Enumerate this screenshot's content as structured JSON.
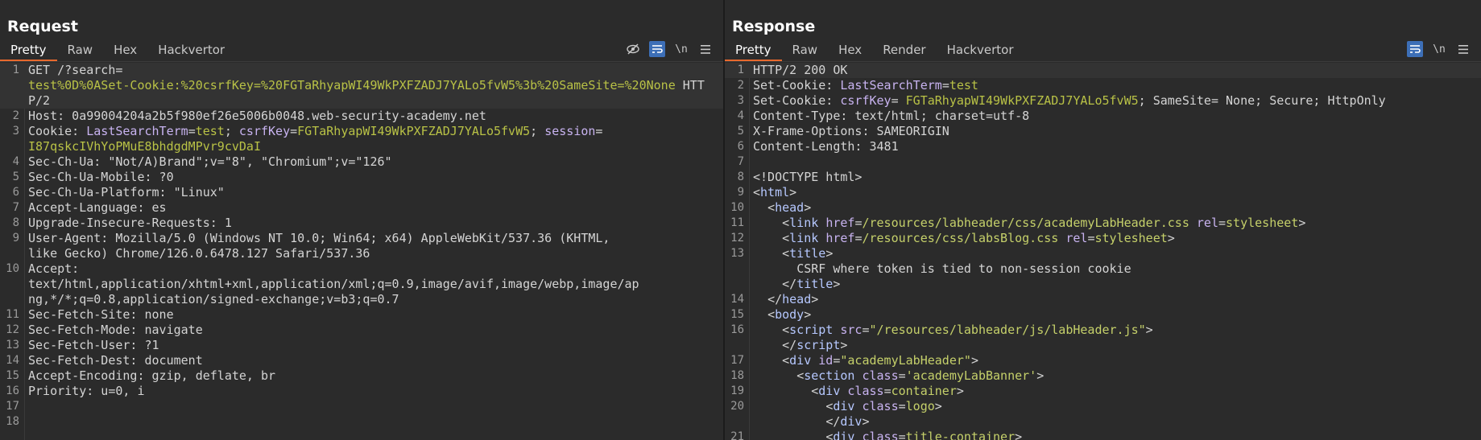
{
  "request": {
    "title": "Request",
    "tabs": [
      "Pretty",
      "Raw",
      "Hex",
      "Hackvertor"
    ],
    "active_tab": "Pretty",
    "icons": {
      "hide": "eye-slash-icon",
      "wrap": "wrap-icon",
      "newline": "\\n",
      "menu": "menu-icon"
    },
    "lines": [
      {
        "n": "1",
        "segs": [
          {
            "t": "GET /?search="
          },
          {
            "t": "\ntest%0D%0ASet-Cookie:%20csrfKey=%20FGTaRhyapWI49WkPXFZADJ7YALo5fvW5%3b%20SameSite=%20None",
            "k": "g"
          },
          {
            "t": " HTTP/2"
          }
        ],
        "hl": true
      },
      {
        "n": "2",
        "segs": [
          {
            "t": "Host: 0a99004204a2b5f980ef26e5006b0048.web-security-academy.net"
          }
        ]
      },
      {
        "n": "3",
        "segs": [
          {
            "t": "Cookie: "
          },
          {
            "t": "LastSearchTerm",
            "k": "c"
          },
          {
            "t": "="
          },
          {
            "t": "test",
            "k": "g"
          },
          {
            "t": "; "
          },
          {
            "t": "csrfKey",
            "k": "c"
          },
          {
            "t": "="
          },
          {
            "t": "FGTaRhyapWI49WkPXFZADJ7YALo5fvW5",
            "k": "g"
          },
          {
            "t": "; "
          },
          {
            "t": "session",
            "k": "c"
          },
          {
            "t": "=\n"
          },
          {
            "t": "I87qskcIVhYoPMuE8bhdgdMPvr9cvDaI",
            "k": "g"
          }
        ]
      },
      {
        "n": "4",
        "segs": [
          {
            "t": "Sec-Ch-Ua: \"Not/A)Brand\";v=\"8\", \"Chromium\";v=\"126\""
          }
        ]
      },
      {
        "n": "5",
        "segs": [
          {
            "t": "Sec-Ch-Ua-Mobile: ?0"
          }
        ]
      },
      {
        "n": "6",
        "segs": [
          {
            "t": "Sec-Ch-Ua-Platform: \"Linux\""
          }
        ]
      },
      {
        "n": "7",
        "segs": [
          {
            "t": "Accept-Language: es"
          }
        ]
      },
      {
        "n": "8",
        "segs": [
          {
            "t": "Upgrade-Insecure-Requests: 1"
          }
        ]
      },
      {
        "n": "9",
        "segs": [
          {
            "t": "User-Agent: Mozilla/5.0 (Windows NT 10.0; Win64; x64) AppleWebKit/537.36 (KHTML,\nlike Gecko) Chrome/126.0.6478.127 Safari/537.36"
          }
        ]
      },
      {
        "n": "10",
        "segs": [
          {
            "t": "Accept:\ntext/html,application/xhtml+xml,application/xml;q=0.9,image/avif,image/webp,image/ap\nng,*/*;q=0.8,application/signed-exchange;v=b3;q=0.7"
          }
        ]
      },
      {
        "n": "11",
        "segs": [
          {
            "t": "Sec-Fetch-Site: none"
          }
        ]
      },
      {
        "n": "12",
        "segs": [
          {
            "t": "Sec-Fetch-Mode: navigate"
          }
        ]
      },
      {
        "n": "13",
        "segs": [
          {
            "t": "Sec-Fetch-User: ?1"
          }
        ]
      },
      {
        "n": "14",
        "segs": [
          {
            "t": "Sec-Fetch-Dest: document"
          }
        ]
      },
      {
        "n": "15",
        "segs": [
          {
            "t": "Accept-Encoding: gzip, deflate, br"
          }
        ]
      },
      {
        "n": "16",
        "segs": [
          {
            "t": "Priority: u=0, i"
          }
        ]
      },
      {
        "n": "17",
        "segs": [
          {
            "t": ""
          }
        ]
      },
      {
        "n": "18",
        "segs": [
          {
            "t": ""
          }
        ]
      }
    ]
  },
  "response": {
    "title": "Response",
    "tabs": [
      "Pretty",
      "Raw",
      "Hex",
      "Render",
      "Hackvertor"
    ],
    "active_tab": "Pretty",
    "icons": {
      "wrap": "wrap-icon",
      "newline": "\\n",
      "menu": "menu-icon"
    },
    "lines": [
      {
        "n": "1",
        "segs": [
          {
            "t": "HTTP/2 200 OK"
          }
        ],
        "hl": true
      },
      {
        "n": "2",
        "segs": [
          {
            "t": "Set-Cookie: "
          },
          {
            "t": "LastSearchTerm",
            "k": "c"
          },
          {
            "t": "="
          },
          {
            "t": "test",
            "k": "g"
          }
        ]
      },
      {
        "n": "3",
        "segs": [
          {
            "t": "Set-Cookie: "
          },
          {
            "t": "csrfKey",
            "k": "c"
          },
          {
            "t": "= "
          },
          {
            "t": "FGTaRhyapWI49WkPXFZADJ7YALo5fvW5",
            "k": "g"
          },
          {
            "t": "; SameSite= None; Secure; HttpOnly"
          }
        ]
      },
      {
        "n": "4",
        "segs": [
          {
            "t": "Content-Type: text/html; charset=utf-8"
          }
        ]
      },
      {
        "n": "5",
        "segs": [
          {
            "t": "X-Frame-Options: SAMEORIGIN"
          }
        ]
      },
      {
        "n": "6",
        "segs": [
          {
            "t": "Content-Length: 3481"
          }
        ]
      },
      {
        "n": "7",
        "segs": [
          {
            "t": ""
          }
        ]
      },
      {
        "n": "8",
        "segs": [
          {
            "t": "<!DOCTYPE html>"
          }
        ]
      },
      {
        "n": "9",
        "segs": [
          {
            "t": "<",
            "k": ""
          },
          {
            "t": "html",
            "k": "t"
          },
          {
            "t": ">"
          }
        ]
      },
      {
        "n": "10",
        "segs": [
          {
            "t": "  <"
          },
          {
            "t": "head",
            "k": "t"
          },
          {
            "t": ">"
          }
        ]
      },
      {
        "n": "11",
        "segs": [
          {
            "t": "    <"
          },
          {
            "t": "link",
            "k": "t"
          },
          {
            "t": " "
          },
          {
            "t": "href",
            "k": "a"
          },
          {
            "t": "="
          },
          {
            "t": "/resources/labheader/css/academyLabHeader.css",
            "k": "s"
          },
          {
            "t": " "
          },
          {
            "t": "rel",
            "k": "a"
          },
          {
            "t": "="
          },
          {
            "t": "stylesheet",
            "k": "s"
          },
          {
            "t": ">"
          }
        ]
      },
      {
        "n": "12",
        "segs": [
          {
            "t": "    <"
          },
          {
            "t": "link",
            "k": "t"
          },
          {
            "t": " "
          },
          {
            "t": "href",
            "k": "a"
          },
          {
            "t": "="
          },
          {
            "t": "/resources/css/labsBlog.css",
            "k": "s"
          },
          {
            "t": " "
          },
          {
            "t": "rel",
            "k": "a"
          },
          {
            "t": "="
          },
          {
            "t": "stylesheet",
            "k": "s"
          },
          {
            "t": ">"
          }
        ]
      },
      {
        "n": "13",
        "segs": [
          {
            "t": "    <"
          },
          {
            "t": "title",
            "k": "t"
          },
          {
            "t": ">\n      CSRF where token is tied to non-session cookie\n    </"
          },
          {
            "t": "title",
            "k": "t"
          },
          {
            "t": ">"
          }
        ]
      },
      {
        "n": "14",
        "segs": [
          {
            "t": "  </"
          },
          {
            "t": "head",
            "k": "t"
          },
          {
            "t": ">"
          }
        ]
      },
      {
        "n": "15",
        "segs": [
          {
            "t": "  <"
          },
          {
            "t": "body",
            "k": "t"
          },
          {
            "t": ">"
          }
        ]
      },
      {
        "n": "16",
        "segs": [
          {
            "t": "    <"
          },
          {
            "t": "script",
            "k": "t"
          },
          {
            "t": " "
          },
          {
            "t": "src",
            "k": "a"
          },
          {
            "t": "="
          },
          {
            "t": "\"/resources/labheader/js/labHeader.js\"",
            "k": "s"
          },
          {
            "t": ">\n    </"
          },
          {
            "t": "script",
            "k": "t"
          },
          {
            "t": ">"
          }
        ]
      },
      {
        "n": "17",
        "segs": [
          {
            "t": "    <"
          },
          {
            "t": "div",
            "k": "t"
          },
          {
            "t": " "
          },
          {
            "t": "id",
            "k": "a"
          },
          {
            "t": "="
          },
          {
            "t": "\"academyLabHeader\"",
            "k": "s"
          },
          {
            "t": ">"
          }
        ]
      },
      {
        "n": "18",
        "segs": [
          {
            "t": "      <"
          },
          {
            "t": "section",
            "k": "t"
          },
          {
            "t": " "
          },
          {
            "t": "class",
            "k": "a"
          },
          {
            "t": "="
          },
          {
            "t": "'academyLabBanner'",
            "k": "s"
          },
          {
            "t": ">"
          }
        ]
      },
      {
        "n": "19",
        "segs": [
          {
            "t": "        <"
          },
          {
            "t": "div",
            "k": "t"
          },
          {
            "t": " "
          },
          {
            "t": "class",
            "k": "a"
          },
          {
            "t": "="
          },
          {
            "t": "container",
            "k": "s"
          },
          {
            "t": ">"
          }
        ]
      },
      {
        "n": "20",
        "segs": [
          {
            "t": "          <"
          },
          {
            "t": "div",
            "k": "t"
          },
          {
            "t": " "
          },
          {
            "t": "class",
            "k": "a"
          },
          {
            "t": "="
          },
          {
            "t": "logo",
            "k": "s"
          },
          {
            "t": ">\n          </"
          },
          {
            "t": "div",
            "k": "t"
          },
          {
            "t": ">"
          }
        ]
      },
      {
        "n": "21",
        "segs": [
          {
            "t": "          <"
          },
          {
            "t": "div",
            "k": "t"
          },
          {
            "t": " "
          },
          {
            "t": "class",
            "k": "a"
          },
          {
            "t": "="
          },
          {
            "t": "title-container",
            "k": "s"
          },
          {
            "t": ">"
          }
        ]
      }
    ]
  },
  "layout_buttons": [
    "split-horizontal-icon",
    "split-vertical-icon",
    "tabs-view-icon"
  ]
}
